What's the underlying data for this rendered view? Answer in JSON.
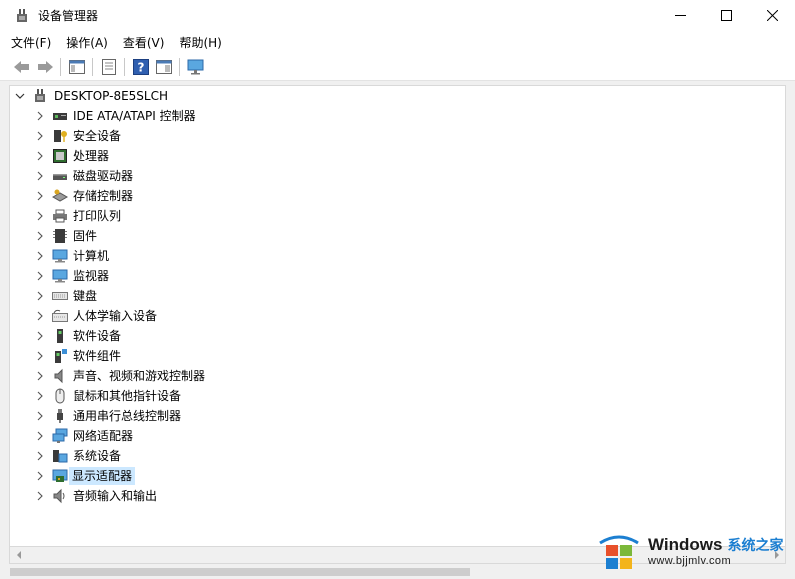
{
  "window": {
    "title": "设备管理器",
    "icon": "device-manager-icon",
    "controls": [
      "minimize-icon",
      "maximize-icon",
      "close-icon"
    ]
  },
  "menubar": {
    "items": [
      {
        "label": "文件(F)"
      },
      {
        "label": "操作(A)"
      },
      {
        "label": "查看(V)"
      },
      {
        "label": "帮助(H)"
      }
    ]
  },
  "toolbar": {
    "buttons": [
      "back-arrow-icon",
      "forward-arrow-icon",
      "show-hide-console-tree-icon",
      "properties-icon",
      "help-icon",
      "action-pane-icon",
      "computer-monitor-icon"
    ]
  },
  "tree": {
    "root": {
      "label": "DESKTOP-8E5SLCH",
      "icon": "computer-icon"
    },
    "items": [
      {
        "label": "IDE ATA/ATAPI 控制器",
        "icon": "ide-controller-icon"
      },
      {
        "label": "安全设备",
        "icon": "security-device-icon"
      },
      {
        "label": "处理器",
        "icon": "processor-icon"
      },
      {
        "label": "磁盘驱动器",
        "icon": "disk-drive-icon"
      },
      {
        "label": "存储控制器",
        "icon": "storage-controller-icon"
      },
      {
        "label": "打印队列",
        "icon": "printer-icon"
      },
      {
        "label": "固件",
        "icon": "firmware-icon"
      },
      {
        "label": "计算机",
        "icon": "computer-monitor-icon"
      },
      {
        "label": "监视器",
        "icon": "monitor-icon"
      },
      {
        "label": "键盘",
        "icon": "keyboard-icon"
      },
      {
        "label": "人体学输入设备",
        "icon": "hid-icon"
      },
      {
        "label": "软件设备",
        "icon": "software-device-icon"
      },
      {
        "label": "软件组件",
        "icon": "software-component-icon"
      },
      {
        "label": "声音、视频和游戏控制器",
        "icon": "speaker-icon"
      },
      {
        "label": "鼠标和其他指针设备",
        "icon": "mouse-icon"
      },
      {
        "label": "通用串行总线控制器",
        "icon": "usb-icon"
      },
      {
        "label": "网络适配器",
        "icon": "network-adapter-icon"
      },
      {
        "label": "系统设备",
        "icon": "system-device-icon"
      },
      {
        "label": "显示适配器",
        "icon": "display-adapter-icon",
        "selected": true
      },
      {
        "label": "音频输入和输出",
        "icon": "audio-io-icon"
      }
    ]
  },
  "watermark": {
    "brand": "Windows",
    "cn": "系统之家",
    "url": "www.bjjmlv.com",
    "icon": "windows-logo-icon"
  }
}
